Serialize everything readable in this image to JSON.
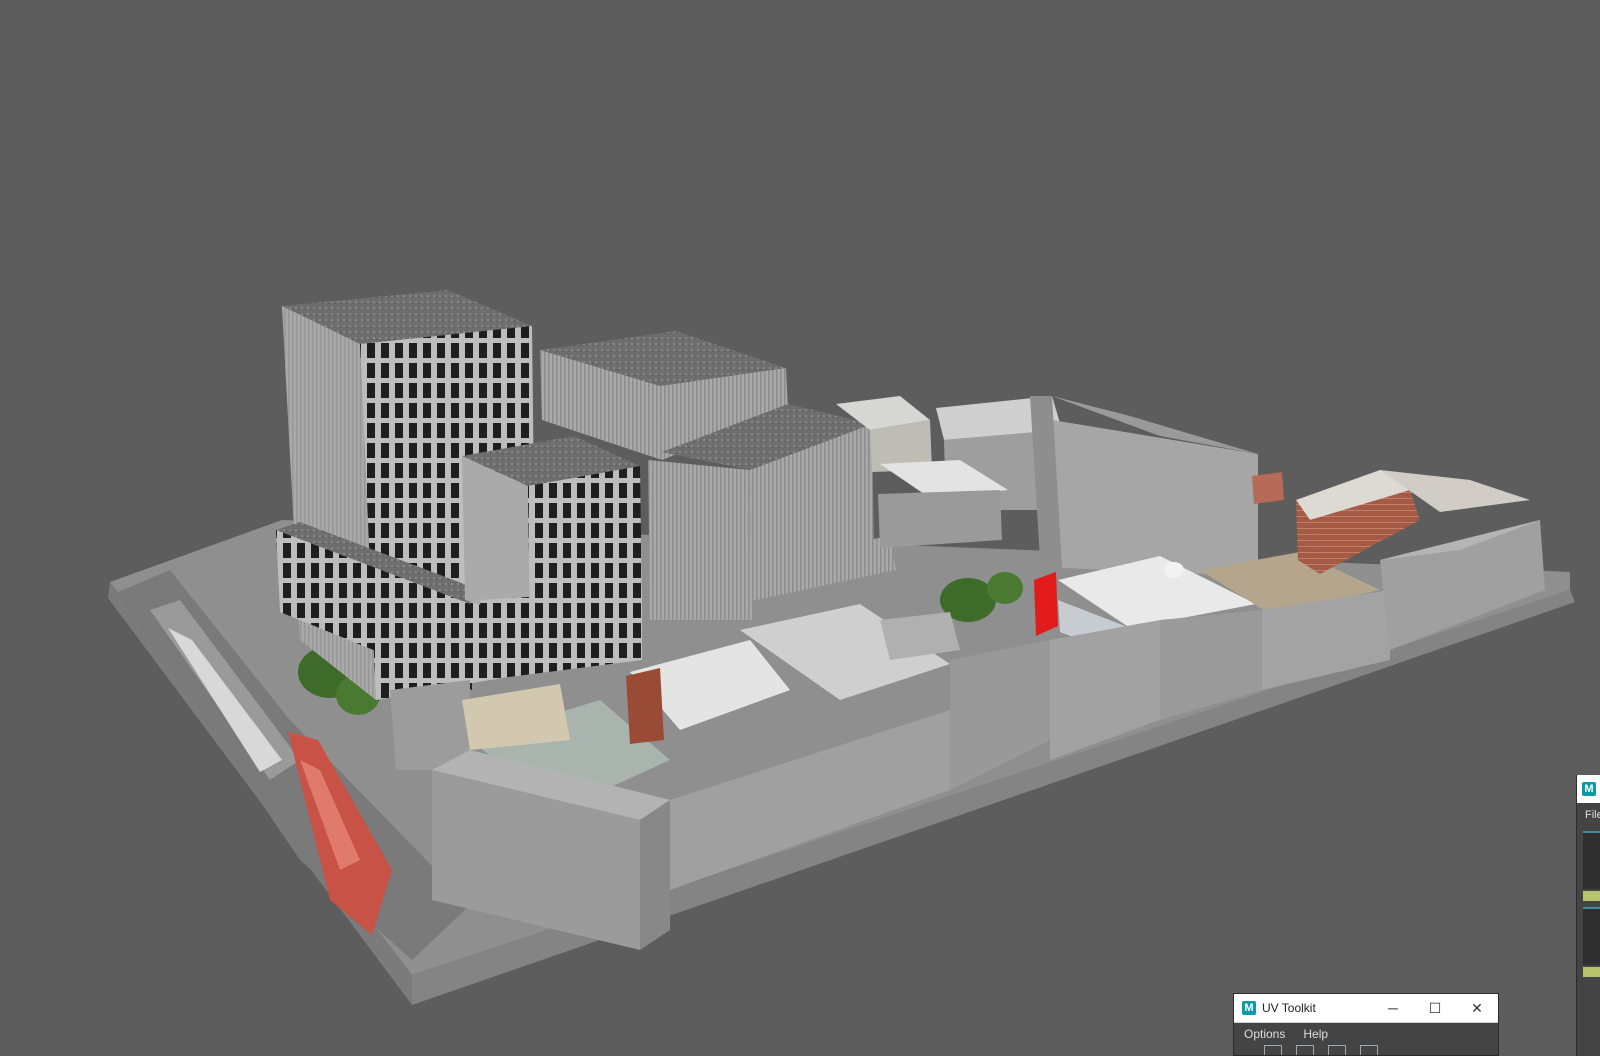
{
  "viewport": {
    "background": "#5d5d5d",
    "highlight_color": "#e11b1b"
  },
  "uv_toolkit": {
    "title": "UV Toolkit",
    "menu": [
      "Options",
      "Help"
    ],
    "controls": {
      "minimize": "─",
      "maximize": "☐",
      "close": "✕"
    },
    "logo": "M"
  },
  "side_window": {
    "logo": "M",
    "menu_partial": "File"
  }
}
